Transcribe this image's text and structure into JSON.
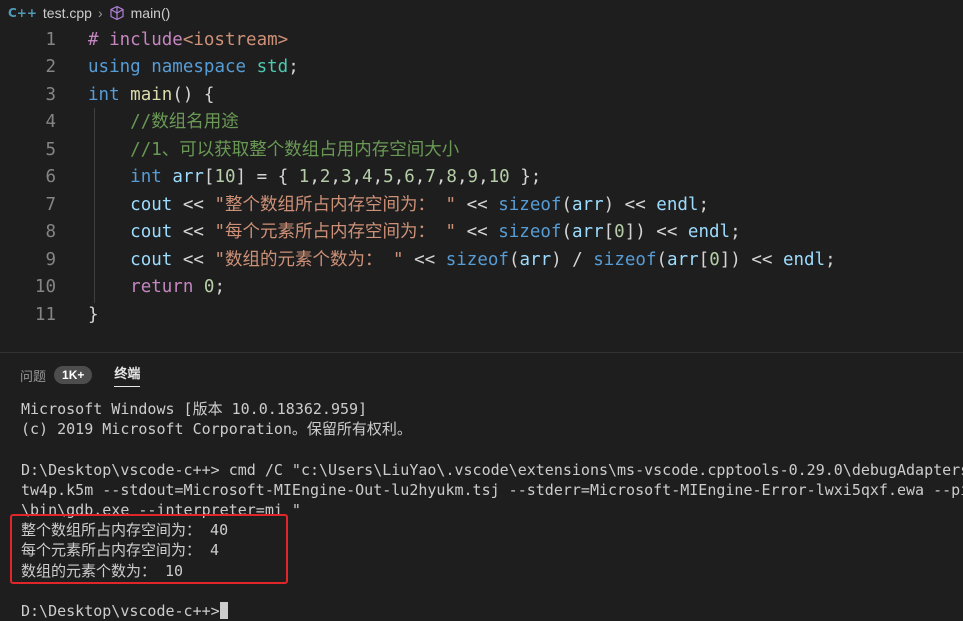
{
  "breadcrumb": {
    "lang_icon": "C++",
    "file": "test.cpp",
    "symbol": "main()"
  },
  "editor": {
    "lines": [
      {
        "n": "1",
        "tokens": [
          [
            "k-prep",
            "# include"
          ],
          [
            "k-inc",
            "<iostream>"
          ]
        ]
      },
      {
        "n": "2",
        "tokens": [
          [
            "k-kw",
            "using"
          ],
          [
            "k-op",
            " "
          ],
          [
            "k-kw",
            "namespace"
          ],
          [
            "k-op",
            " "
          ],
          [
            "k-ns",
            "std"
          ],
          [
            "k-op",
            ";"
          ]
        ]
      },
      {
        "n": "3",
        "tokens": [
          [
            "k-type",
            "int"
          ],
          [
            "k-op",
            " "
          ],
          [
            "k-fn",
            "main"
          ],
          [
            "k-op",
            "() {"
          ]
        ]
      },
      {
        "n": "4",
        "tokens": [
          [
            "k-op",
            "    "
          ],
          [
            "k-cmt",
            "//数组名用途"
          ]
        ]
      },
      {
        "n": "5",
        "tokens": [
          [
            "k-op",
            "    "
          ],
          [
            "k-cmt",
            "//1、可以获取整个数组占用内存空间大小"
          ]
        ]
      },
      {
        "n": "6",
        "tokens": [
          [
            "k-op",
            "    "
          ],
          [
            "k-type",
            "int"
          ],
          [
            "k-op",
            " "
          ],
          [
            "k-var",
            "arr"
          ],
          [
            "k-op",
            "["
          ],
          [
            "k-num",
            "10"
          ],
          [
            "k-op",
            "] = { "
          ],
          [
            "k-num",
            "1"
          ],
          [
            "k-op",
            ","
          ],
          [
            "k-num",
            "2"
          ],
          [
            "k-op",
            ","
          ],
          [
            "k-num",
            "3"
          ],
          [
            "k-op",
            ","
          ],
          [
            "k-num",
            "4"
          ],
          [
            "k-op",
            ","
          ],
          [
            "k-num",
            "5"
          ],
          [
            "k-op",
            ","
          ],
          [
            "k-num",
            "6"
          ],
          [
            "k-op",
            ","
          ],
          [
            "k-num",
            "7"
          ],
          [
            "k-op",
            ","
          ],
          [
            "k-num",
            "8"
          ],
          [
            "k-op",
            ","
          ],
          [
            "k-num",
            "9"
          ],
          [
            "k-op",
            ","
          ],
          [
            "k-num",
            "10"
          ],
          [
            "k-op",
            " };"
          ]
        ]
      },
      {
        "n": "7",
        "tokens": [
          [
            "k-op",
            "    "
          ],
          [
            "k-var",
            "cout"
          ],
          [
            "k-op",
            " << "
          ],
          [
            "k-str",
            "\"整个数组所占内存空间为： \""
          ],
          [
            "k-op",
            " << "
          ],
          [
            "k-kw",
            "sizeof"
          ],
          [
            "k-op",
            "("
          ],
          [
            "k-var",
            "arr"
          ],
          [
            "k-op",
            ") << "
          ],
          [
            "k-var",
            "endl"
          ],
          [
            "k-op",
            ";"
          ]
        ]
      },
      {
        "n": "8",
        "tokens": [
          [
            "k-op",
            "    "
          ],
          [
            "k-var",
            "cout"
          ],
          [
            "k-op",
            " << "
          ],
          [
            "k-str",
            "\"每个元素所占内存空间为： \""
          ],
          [
            "k-op",
            " << "
          ],
          [
            "k-kw",
            "sizeof"
          ],
          [
            "k-op",
            "("
          ],
          [
            "k-var",
            "arr"
          ],
          [
            "k-op",
            "["
          ],
          [
            "k-num",
            "0"
          ],
          [
            "k-op",
            "]) << "
          ],
          [
            "k-var",
            "endl"
          ],
          [
            "k-op",
            ";"
          ]
        ]
      },
      {
        "n": "9",
        "tokens": [
          [
            "k-op",
            "    "
          ],
          [
            "k-var",
            "cout"
          ],
          [
            "k-op",
            " << "
          ],
          [
            "k-str",
            "\"数组的元素个数为： \""
          ],
          [
            "k-op",
            " << "
          ],
          [
            "k-kw",
            "sizeof"
          ],
          [
            "k-op",
            "("
          ],
          [
            "k-var",
            "arr"
          ],
          [
            "k-op",
            ") / "
          ],
          [
            "k-kw",
            "sizeof"
          ],
          [
            "k-op",
            "("
          ],
          [
            "k-var",
            "arr"
          ],
          [
            "k-op",
            "["
          ],
          [
            "k-num",
            "0"
          ],
          [
            "k-op",
            "]) << "
          ],
          [
            "k-var",
            "endl"
          ],
          [
            "k-op",
            ";"
          ]
        ]
      },
      {
        "n": "10",
        "tokens": [
          [
            "k-op",
            "    "
          ],
          [
            "k-ctl",
            "return"
          ],
          [
            "k-op",
            " "
          ],
          [
            "k-num",
            "0"
          ],
          [
            "k-op",
            ";"
          ]
        ]
      },
      {
        "n": "11",
        "tokens": [
          [
            "k-op",
            "}"
          ]
        ]
      }
    ]
  },
  "panel": {
    "tab_problems": "问题",
    "problems_badge": "1K+",
    "tab_terminal": "终端"
  },
  "terminal": {
    "lines": [
      "Microsoft Windows [版本 10.0.18362.959]",
      "(c) 2019 Microsoft Corporation。保留所有权利。",
      "",
      "D:\\Desktop\\vscode-c++> cmd /C \"c:\\Users\\LiuYao\\.vscode\\extensions\\ms-vscode.cpptools-0.29.0\\debugAdapters",
      "tw4p.k5m --stdout=Microsoft-MIEngine-Out-lu2hyukm.tsj --stderr=Microsoft-MIEngine-Error-lwxi5qxf.ewa --pi",
      "\\bin\\gdb.exe --interpreter=mi \"",
      "整个数组所占内存空间为： 40",
      "每个元素所占内存空间为： 4",
      "数组的元素个数为： 10",
      ""
    ],
    "prompt": "D:\\Desktop\\vscode-c++>"
  },
  "colors": {
    "highlight_box": "#e0262b",
    "background": "#1e1e1e"
  }
}
